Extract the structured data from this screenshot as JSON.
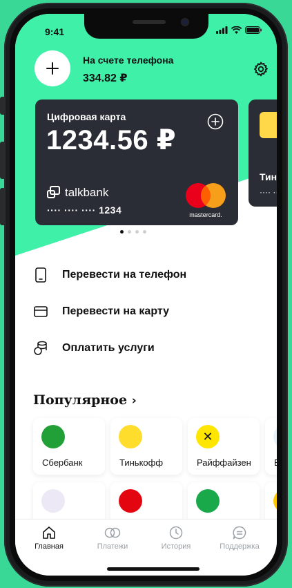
{
  "status_bar": {
    "time": "9:41"
  },
  "header": {
    "balance_label": "На счете телефона",
    "balance_value": "334.82 ₽"
  },
  "cards": [
    {
      "title": "Цифровая карта",
      "amount": "1234.56 ₽",
      "brand": "talkbank",
      "number": "···· ···· ···· 1234",
      "network": "mastercard."
    },
    {
      "name": "Тинькофф",
      "number": "···· ····"
    }
  ],
  "carousel": {
    "count": 4,
    "active": 0
  },
  "actions": [
    {
      "label": "Перевести на телефон",
      "icon": "phone-icon"
    },
    {
      "label": "Перевести на карту",
      "icon": "card-icon"
    },
    {
      "label": "Оплатить услуги",
      "icon": "coins-icon"
    }
  ],
  "popular": {
    "title": "Популярное",
    "items": [
      {
        "name": "Сбербанк",
        "color": "#21a038"
      },
      {
        "name": "Тинькофф",
        "color": "#ffdd2d"
      },
      {
        "name": "Райффайзен",
        "color": "#fee600"
      },
      {
        "name": "Би",
        "color": "#0b8fd6"
      },
      {
        "name": "",
        "color": "#7a3cf2"
      },
      {
        "name": "",
        "color": "#e30611"
      },
      {
        "name": "",
        "color": "#19a84a"
      },
      {
        "name": "",
        "color": "#ffc800"
      }
    ]
  },
  "tabbar": [
    {
      "label": "Главная",
      "active": true
    },
    {
      "label": "Платежи",
      "active": false
    },
    {
      "label": "История",
      "active": false
    },
    {
      "label": "Поддержка",
      "active": false
    }
  ],
  "colors": {
    "accent": "#3ff0a8",
    "card_bg": "#2b2d36",
    "background": "#3ad896"
  }
}
